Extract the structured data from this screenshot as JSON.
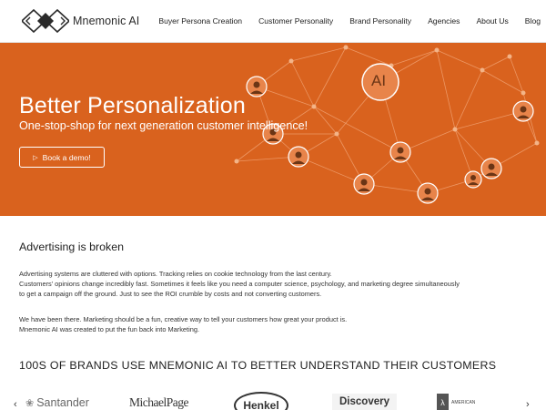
{
  "brand": {
    "name": "Mnemonic AI"
  },
  "nav": {
    "items": [
      {
        "label": "Buyer Persona Creation"
      },
      {
        "label": "Customer Personality"
      },
      {
        "label": "Brand Personality"
      },
      {
        "label": "Agencies"
      },
      {
        "label": "About Us"
      },
      {
        "label": "Blog"
      }
    ]
  },
  "hero": {
    "title": "Better Personalization",
    "subtitle": "One-stop-shop for next generation customer intelligence!",
    "cta": "Book a demo!",
    "ai_badge": "AI",
    "background": "#d9621e"
  },
  "section1": {
    "title": "Advertising is broken",
    "lines": [
      "Advertising systems are cluttered with options. Tracking relies on cookie technology from the last century.",
      "Customers’ opinions change incredibly fast. Sometimes it feels like you need a computer science, psychology, and marketing degree simultaneously",
      "to get a campaign off the ground. Just to see the ROI crumble by costs and not converting customers."
    ],
    "lines2": [
      "We have been there. Marketing should be a fun, creative way to tell your customers how great your product is.",
      "Mnemonic AI was created to put the fun back into Marketing."
    ]
  },
  "brands": {
    "title": "100S OF BRANDS USE MNEMONIC AI TO BETTER UNDERSTAND THEIR CUSTOMERS",
    "logos": [
      "Santander",
      "MichaelPage",
      "Henkel",
      "Discovery",
      "AMERICAN"
    ],
    "prev_icon": "chevron-left-icon",
    "next_icon": "chevron-right-icon"
  }
}
